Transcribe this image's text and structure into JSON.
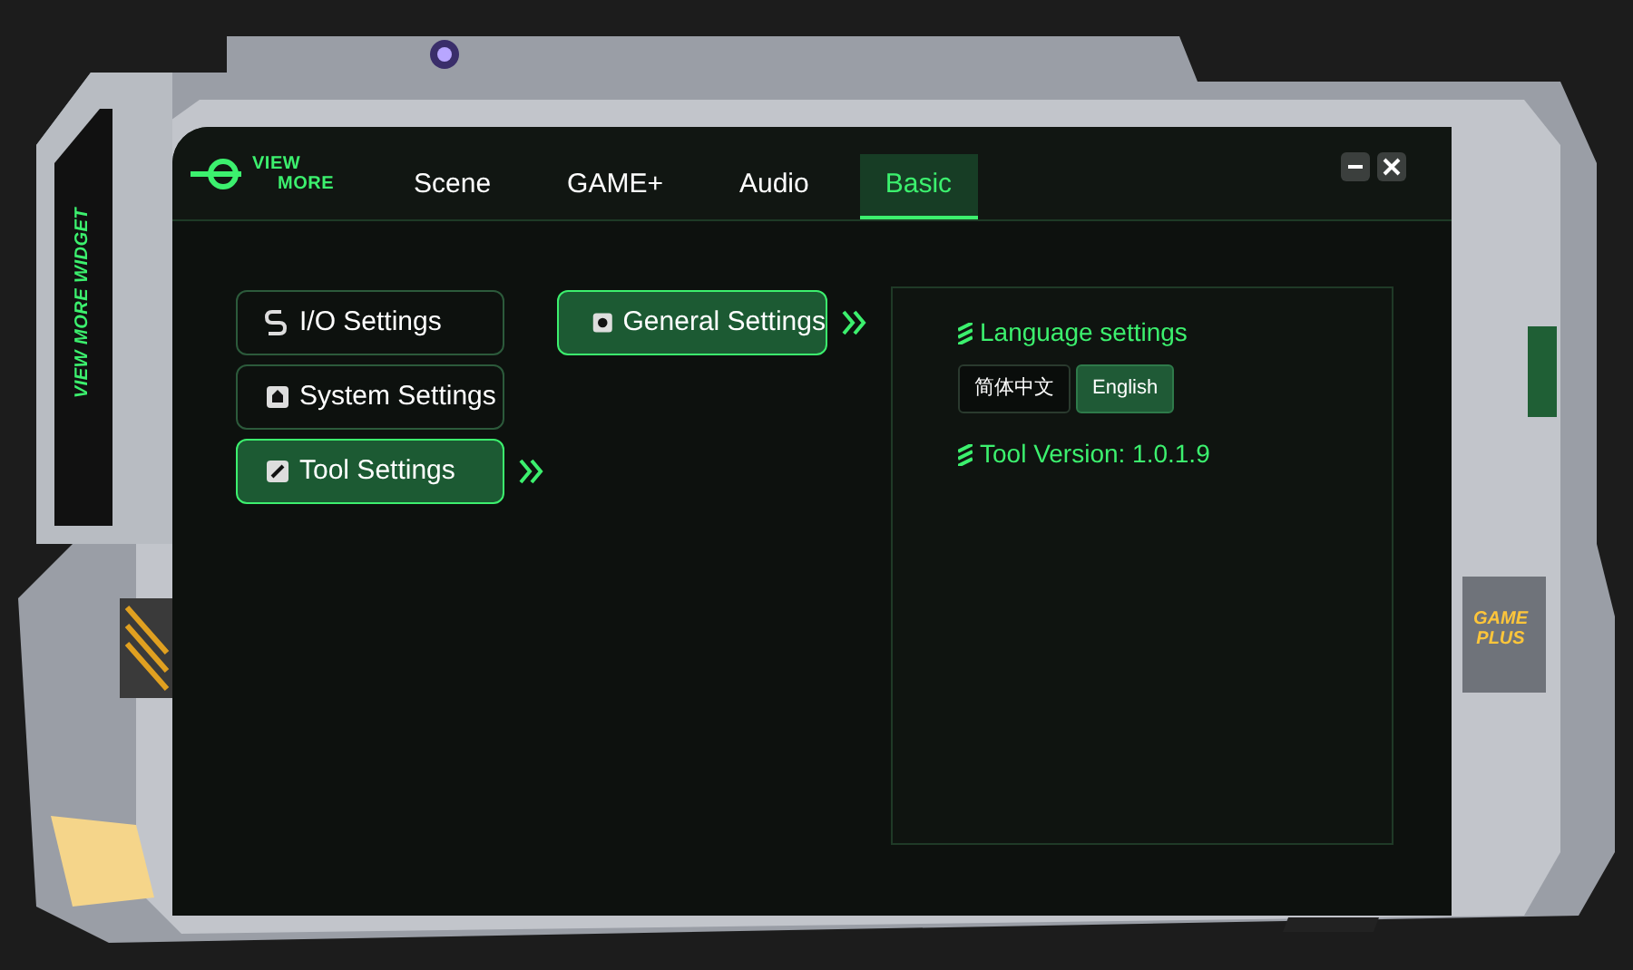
{
  "side_label": "VIEW MORE WIDGET",
  "badge": {
    "lines": [
      "GAME",
      "PLUS"
    ]
  },
  "logo": {
    "lines": [
      "VIEW",
      "MORE"
    ]
  },
  "tabs": [
    {
      "label": "Scene",
      "selected": false
    },
    {
      "label": "GAME+",
      "selected": false
    },
    {
      "label": "Audio",
      "selected": false
    },
    {
      "label": "Basic",
      "selected": true
    }
  ],
  "menu": [
    {
      "label": "I/O Settings",
      "selected": false
    },
    {
      "label": "System Settings",
      "selected": false
    },
    {
      "label": "Tool Settings",
      "selected": true
    }
  ],
  "submenu": [
    {
      "label": "General Settings",
      "selected": true
    }
  ],
  "panel": {
    "language_heading": "Language settings",
    "languages": [
      {
        "label": "简体中文",
        "selected": false
      },
      {
        "label": "English",
        "selected": true
      }
    ],
    "version": "Tool Version: 1.0.1.9"
  }
}
